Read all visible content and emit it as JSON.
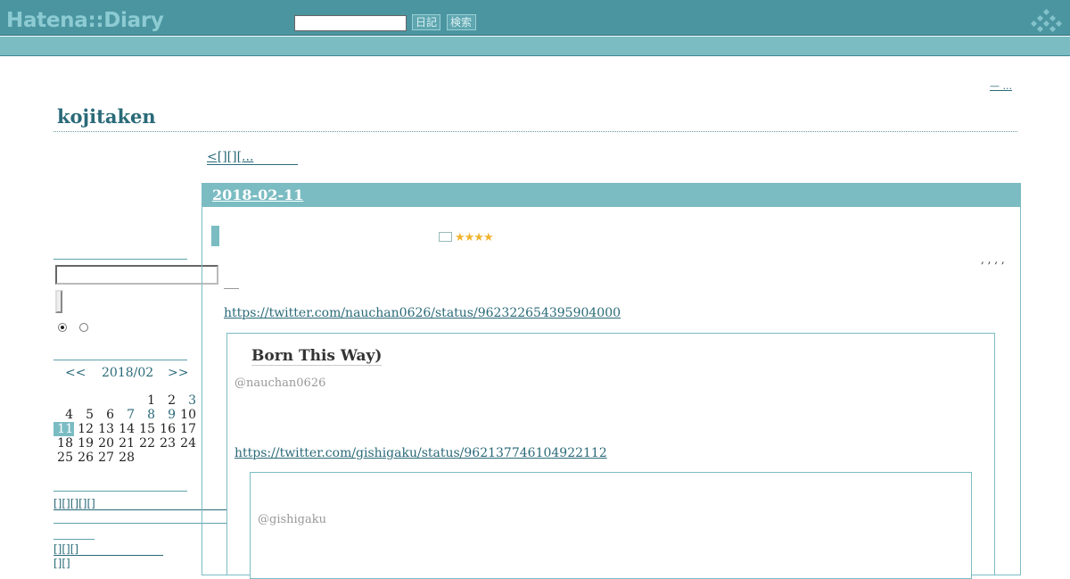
{
  "header": {
    "logo": "Hatena::Diary",
    "search_placeholder": "",
    "diary_button": "日記",
    "search_button": "検索"
  },
  "top_right_link": "— ...",
  "blog_title": "kojitaken",
  "sidebar": {
    "search_value": "",
    "radio_1_checked": true,
    "radio_2_checked": false,
    "calendar": {
      "prev": "<<",
      "month": "2018/02",
      "next": ">>",
      "weeks": [
        [
          "",
          "",
          "",
          "",
          "1",
          "2",
          "3"
        ],
        [
          "4",
          "5",
          "6",
          "7",
          "8",
          "9",
          "10"
        ],
        [
          "11",
          "12",
          "13",
          "14",
          "15",
          "16",
          "17"
        ],
        [
          "18",
          "19",
          "20",
          "21",
          "22",
          "23",
          "24"
        ],
        [
          "25",
          "26",
          "27",
          "28",
          "",
          "",
          ""
        ]
      ],
      "linked_days": [
        "3",
        "7",
        "8",
        "9"
      ],
      "today": "11"
    },
    "links_1": "[][][][][]",
    "links_2": "[][][]",
    "links_3": "[][]"
  },
  "main": {
    "prev_link": "<[][][...",
    "date": "2018-02-11",
    "stars": "★★★★",
    "tags": ", , , ,",
    "tweet1_url": "https://twitter.com/nauchan0626/status/962322654395904000",
    "tweet1_title": "Born This Way)",
    "tweet1_handle": "@nauchan0626",
    "tweet2_url": "https://twitter.com/gishigaku/status/962137746104922112",
    "tweet2_handle": "@gishigaku"
  },
  "colors": {
    "header": "#4a95a0",
    "accent": "#7bbcc3",
    "link": "#2a6a78"
  }
}
